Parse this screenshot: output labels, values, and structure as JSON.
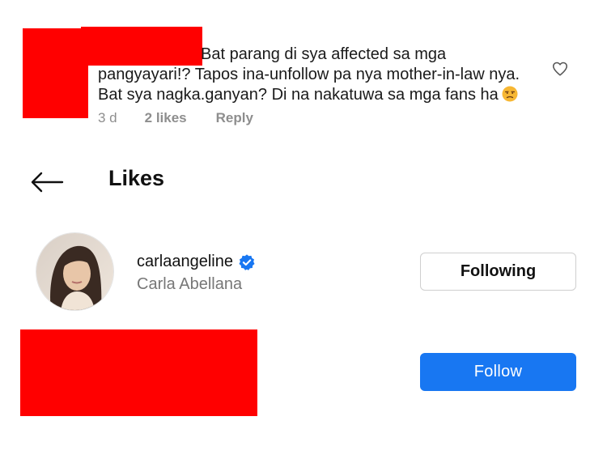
{
  "comment": {
    "lines": [
      "Bat parang di sya affected sa mga",
      "pangyayari!? Tapos ina-unfollow pa nya mother-in-law nya.",
      "Bat sya nagka.ganyan? Di na nakatuwa sa mga fans ha"
    ],
    "emoji": "unamused-face-emoji",
    "time": "3 d",
    "likes": "2 likes",
    "reply": "Reply",
    "heart_icon": "heart-outline-icon"
  },
  "likes_screen": {
    "title": "Likes",
    "back_icon": "arrow-left-icon"
  },
  "users": [
    {
      "username": "carlaangeline",
      "full_name": "Carla Abellana",
      "verified": true,
      "button": "Following"
    },
    {
      "button": "Follow"
    }
  ],
  "colors": {
    "redaction": "#ff0000",
    "follow_button": "#1877f2",
    "verified_badge": "#1877f2",
    "muted_text": "#8e8e8e"
  }
}
